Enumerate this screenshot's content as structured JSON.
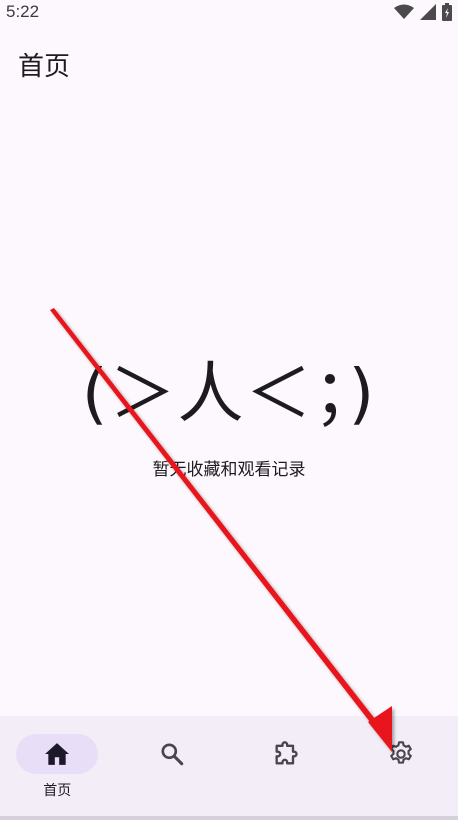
{
  "status_bar": {
    "time": "5:22",
    "icons": [
      "wifi-icon",
      "signal-icon",
      "battery-icon"
    ]
  },
  "header": {
    "title": "首页"
  },
  "empty_state": {
    "kaomoji": "(＞人＜；)",
    "message": "暂无收藏和观看记录"
  },
  "bottom_nav": {
    "items": [
      {
        "icon": "home-icon",
        "label": "首页",
        "active": true
      },
      {
        "icon": "search-icon",
        "label": "",
        "active": false
      },
      {
        "icon": "puzzle-icon",
        "label": "",
        "active": false
      },
      {
        "icon": "gear-icon",
        "label": "",
        "active": false
      }
    ]
  },
  "colors": {
    "background": "#fdf8fd",
    "nav_background": "#f3edf7",
    "active_pill": "#e8def8",
    "annotation_arrow": "#e8151a"
  }
}
